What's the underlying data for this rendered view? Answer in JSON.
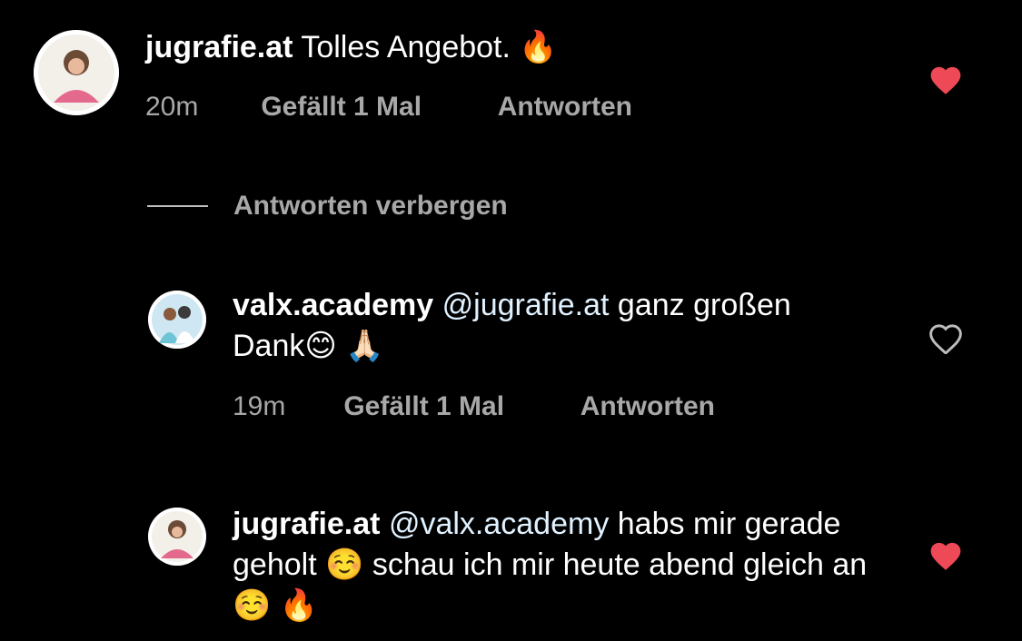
{
  "comments": [
    {
      "username": "jugrafie.at",
      "mention": "",
      "text": "Tolles Angebot. 🔥",
      "time": "20m",
      "likes": "Gefällt 1 Mal",
      "reply": "Antworten",
      "liked": true,
      "avatar_icon": "jugrafie-avatar"
    },
    {
      "username": "valx.academy",
      "mention": "@jugrafie.at",
      "text": " ganz großen Dank😊 🙏🏻",
      "time": "19m",
      "likes": "Gefällt 1 Mal",
      "reply": "Antworten",
      "liked": false,
      "avatar_icon": "valx-academy-avatar"
    },
    {
      "username": "jugrafie.at",
      "mention": "@valx.academy",
      "text": " habs mir gerade geholt ☺️ schau ich mir heute abend gleich an ☺️ 🔥",
      "liked": true,
      "avatar_icon": "jugrafie-avatar"
    }
  ],
  "hide_replies_label": "Antworten verbergen",
  "colors": {
    "background": "#000000",
    "liked_heart": "#ed4956",
    "meta_text": "#a8a8a8",
    "mention": "#e0f1ff"
  }
}
